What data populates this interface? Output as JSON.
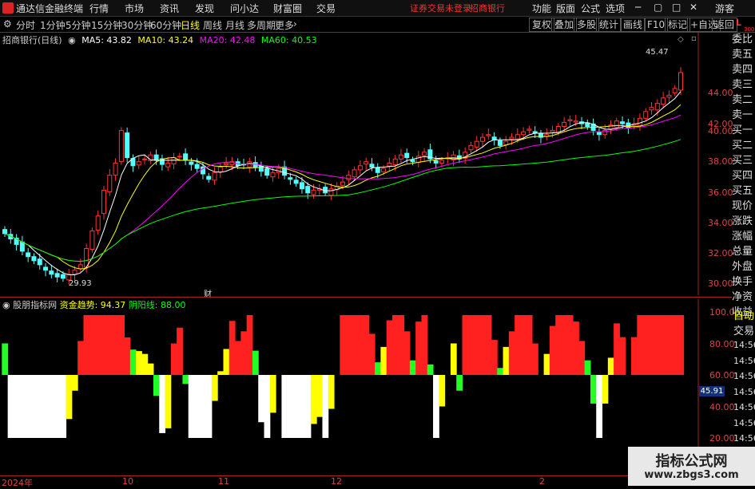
{
  "menubar": {
    "app_title": "通达信金融终端",
    "items": [
      "行情",
      "市场",
      "资讯",
      "发现",
      "问小达",
      "财富圈",
      "交易"
    ],
    "notice1": "证券交易未登录",
    "notice2": "招商银行",
    "right_items": [
      "功能",
      "版面",
      "公式",
      "选项"
    ],
    "guest": "游客"
  },
  "toolbar": {
    "periods": [
      "分时",
      "1分钟",
      "5分钟",
      "15分钟",
      "30分钟",
      "60分钟",
      "日线",
      "周线",
      "月线",
      "多周期",
      "更多"
    ],
    "active": "日线",
    "right_buttons": [
      "复权",
      "叠加",
      "多股",
      "统计",
      "画线",
      "F10",
      "标记",
      "+自选",
      "返回"
    ]
  },
  "ma": {
    "stock": "招商银行(日线)",
    "ma5": "MA5: 43.82",
    "ma10": "MA10: 43.24",
    "ma20": "MA20: 42.48",
    "ma60": "MA60: 40.53",
    "colors": {
      "ma5": "#ffffff",
      "ma10": "#ffff00",
      "ma20": "#ff00ff",
      "ma60": "#00ff00"
    }
  },
  "price_axis": [
    "44.00",
    "42.00",
    "40.00",
    "38.00",
    "36.00",
    "34.00",
    "32.00",
    "30.00"
  ],
  "annotations": {
    "high": "45.47",
    "low": "29.93",
    "cai": "财"
  },
  "indicator": {
    "name": "股朋指标网",
    "trend": "资金趋势: 94.37",
    "yinyang": "阴阳线: 88.00",
    "axis": [
      "100.0",
      "80.00",
      "60.00",
      "40.00",
      "20.00"
    ],
    "current": "45.91"
  },
  "side_panel": [
    "委比",
    "卖五",
    "卖四",
    "卖三",
    "卖二",
    "卖一",
    "买一",
    "买二",
    "买三",
    "买四",
    "买五",
    "现价",
    "涨跌",
    "涨幅",
    "总量",
    "外盘",
    "换手",
    "净资",
    "收益"
  ],
  "side_extra": [
    "自动",
    "交易"
  ],
  "side_times": [
    "14:56",
    "14:56",
    "14:56",
    "14:56",
    "14:56",
    "14:56",
    "14:56",
    "14:56"
  ],
  "x_axis": [
    "2024年",
    "10",
    "11",
    "12",
    "2"
  ],
  "corner": {
    "l": "L",
    "num": "300"
  },
  "watermark": {
    "title": "指标公式网",
    "url": "www.zbgs3.com"
  },
  "chart_data": {
    "type": "candlestick",
    "close": [
      33.6,
      33.2,
      32.8,
      32.3,
      31.9,
      31.6,
      31.3,
      30.9,
      30.6,
      30.4,
      30.3,
      30.6,
      30.9,
      31.3,
      32.5,
      33.8,
      34.9,
      36.8,
      37.9,
      38.8,
      41.2,
      39.2,
      38.6,
      38.9,
      39.1,
      39.4,
      39.0,
      38.7,
      38.8,
      39.2,
      39.3,
      39.0,
      38.7,
      38.4,
      38.0,
      37.6,
      38.1,
      38.5,
      38.8,
      38.9,
      38.6,
      38.7,
      38.9,
      38.5,
      38.2,
      37.9,
      38.1,
      38.4,
      37.9,
      37.6,
      37.3,
      36.9,
      36.6,
      36.8,
      36.9,
      36.6,
      36.9,
      37.1,
      37.4,
      37.9,
      38.3,
      38.6,
      38.9,
      38.5,
      38.1,
      38.4,
      38.8,
      39.1,
      39.4,
      39.2,
      38.9,
      39.3,
      39.6,
      39.1,
      38.8,
      39.0,
      39.2,
      39.4,
      39.1,
      39.6,
      40.1,
      40.4,
      40.7,
      40.9,
      40.5,
      40.1,
      40.4,
      40.7,
      40.9,
      41.1,
      41.3,
      41.0,
      40.7,
      40.9,
      41.2,
      41.5,
      41.8,
      42.0,
      41.9,
      41.7,
      41.5,
      41.2,
      40.9,
      41.2,
      41.6,
      41.9,
      41.7,
      41.4,
      41.7,
      42.1,
      42.6,
      42.9,
      43.2,
      43.6,
      43.8,
      44.3,
      45.47
    ],
    "ma60_end": 40.53,
    "indicator_series": "资金趋势"
  }
}
